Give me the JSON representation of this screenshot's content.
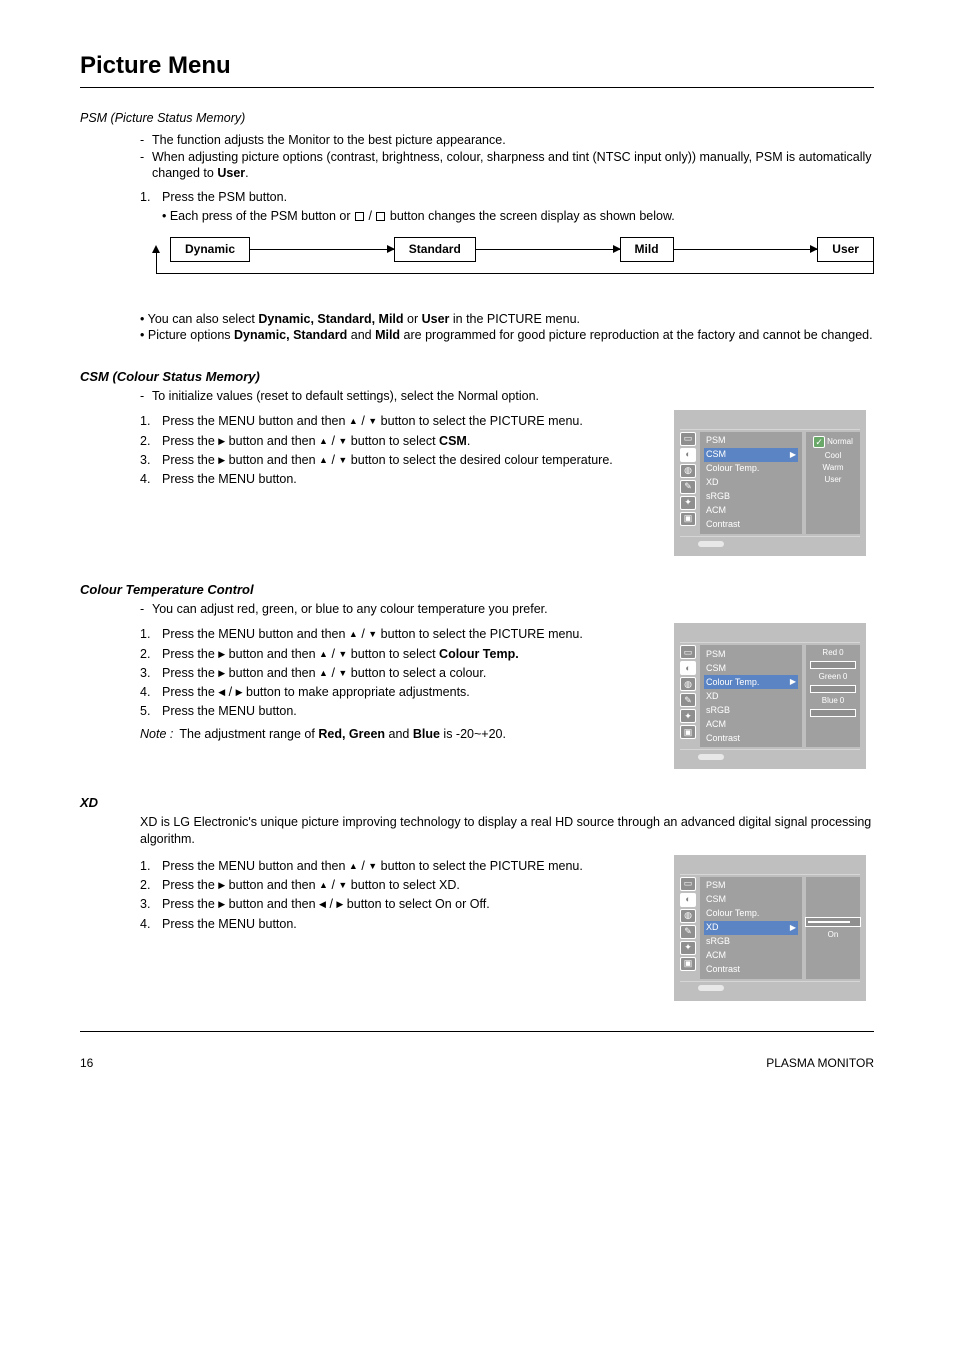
{
  "page": {
    "title": "Picture Menu",
    "section_psm": {
      "label": "PSM (Picture Status Memory)",
      "dash1": "The function adjusts the Monitor to the best picture appearance.",
      "dash2_a": "When adjusting picture options (contrast, brightness, colour, sharpness and tint (NTSC input only)) manually, PSM is automatically changed to",
      "dash2_user": "User",
      "dash2_b": ".",
      "step1": "Press the PSM button.",
      "step_bullet": "• Each press of the PSM button or ",
      "step_bullet_end": " button changes the screen display as shown below.",
      "flow": [
        "Dynamic",
        "Standard",
        "Mild",
        "User"
      ],
      "bullet1_a": "You can also select ",
      "bullet1_modes": "Dynamic, Standard, Mild",
      "bullet1_b": " or ",
      "bullet1_user": "User",
      "bullet1_c": " in the PICTURE menu.",
      "bullet2_a": "Picture options ",
      "bullet2_modes": "Dynamic, Standard",
      "bullet2_b": " and ",
      "bullet2_mild": "Mild",
      "bullet2_c": " are programmed for good picture reproduction at the factory and cannot be changed."
    },
    "csm": {
      "heading": "CSM (Colour Status Memory)",
      "dash": "To initialize values (reset to default settings), select the Normal option.",
      "s1": "Press the MENU button and then ",
      "s1b": " button to select the PICTURE menu.",
      "s2a": "Press the ",
      "s2b": " button and then ",
      "s2c": " button to select ",
      "s2_csm": "CSM",
      "s2d": ".",
      "s3a": "Press the ",
      "s3b": " button and then ",
      "s3c": " button to select the desired colour temperature.",
      "s4": "Press the MENU button.",
      "osd": {
        "rows": [
          "PSM",
          "CSM",
          "Colour Temp.",
          "XD",
          "sRGB",
          "ACM",
          "Contrast"
        ],
        "sel_index": 1,
        "sub_opts": [
          "Normal",
          "Cool",
          "Warm",
          "User"
        ]
      }
    },
    "colour_temp": {
      "heading": "Colour Temperature Control",
      "dash": "You can adjust red, green, or blue to any colour temperature you prefer.",
      "s1": "Press the MENU button and then ",
      "s1b": " button to select the PICTURE menu.",
      "s2a": "Press the ",
      "s2b": " button and then ",
      "s2c": " button to select ",
      "s2_key": "Colour Temp.",
      "s3a": "Press the ",
      "s3b": " button and then ",
      "s3c": " button to select a colour.",
      "s4a": "Press the ",
      "s4b": " button to make appropriate adjustments.",
      "s5": "Press the MENU button.",
      "range_a": "The adjustment range of ",
      "range_rgb": "Red, Green",
      "range_and": " and ",
      "range_blue": "Blue",
      "range_b": " is -20~+20.",
      "osd": {
        "sel_index": 2,
        "sub": [
          "Red",
          "Green",
          "Blue"
        ],
        "vals": [
          "0",
          "0",
          "0"
        ]
      }
    },
    "xd": {
      "heading": "XD",
      "desc": "XD is LG Electronic's unique picture improving technology to display a real HD source through an advanced digital signal processing algorithm.",
      "s1": "Press the MENU button and then ",
      "s1b": " button to select the PICTURE menu.",
      "s2a": "Press the ",
      "s2b": " button and then ",
      "s2c": " button to select XD.",
      "s3a": "Press the ",
      "s3b": " button and then ",
      "s3c": " button to select On or Off.",
      "s4": "Press the MENU button.",
      "osd": {
        "sel_index": 3,
        "val": "On"
      }
    },
    "note_label": "Note :",
    "osd_rows": [
      "PSM",
      "CSM",
      "Colour Temp.",
      "XD",
      "sRGB",
      "ACM",
      "Contrast"
    ],
    "footer": {
      "left": "16",
      "right": "PLASMA MONITOR"
    }
  }
}
